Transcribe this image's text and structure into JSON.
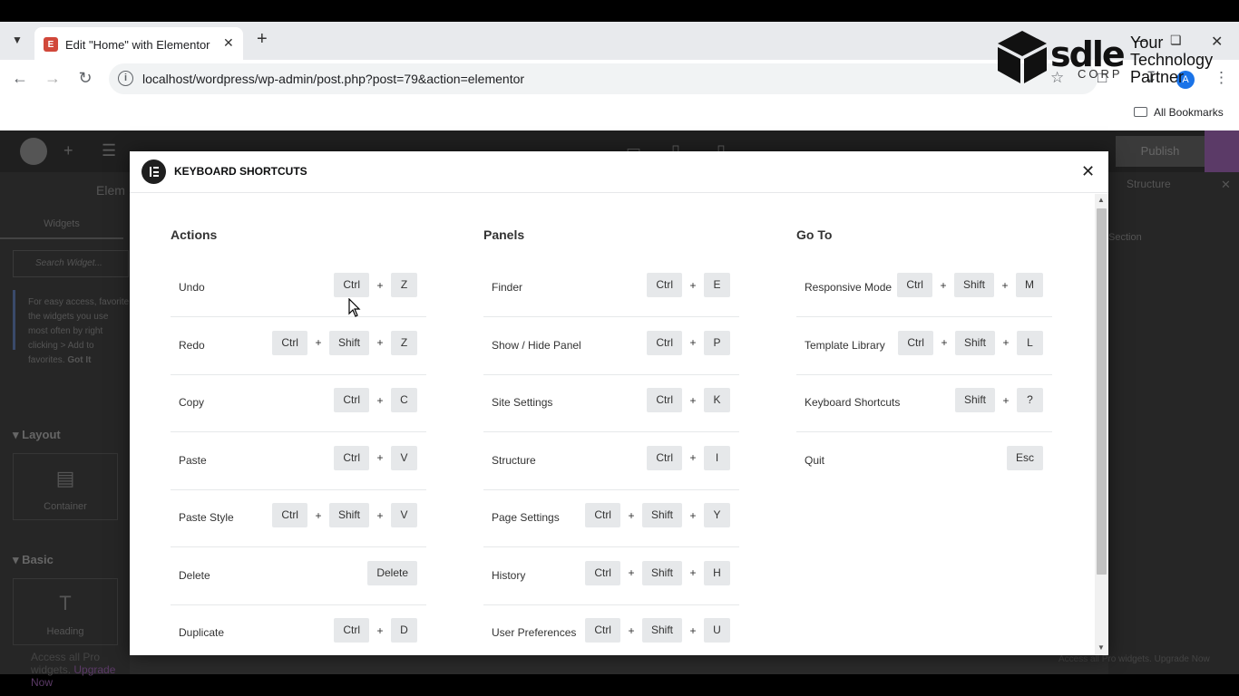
{
  "browser": {
    "tab_title": "Edit \"Home\" with Elementor",
    "url": "localhost/wordpress/wp-admin/post.php?post=79&action=elementor",
    "bookmarks_label": "All Bookmarks",
    "avatar_letter": "A"
  },
  "watermark": {
    "brand": "sdle",
    "corp": "CORP",
    "tagline": "Your Technology Partner"
  },
  "editor": {
    "left_title": "Elem",
    "left_tab": "Widgets",
    "search_placeholder": "Search Widget...",
    "note_text": "For easy access, favorite the widgets you use most often by right clicking > Add to favorites.",
    "note_link": "Got It",
    "section_layout": "Layout",
    "widget_container": "Container",
    "section_basic": "Basic",
    "widget_heading": "Heading",
    "pro_text": "Access all Pro widgets.",
    "pro_link": "Upgrade Now",
    "right_title": "Structure",
    "right_section": "Section",
    "right_pro": "Access all Pro widgets. Upgrade Now",
    "publish": "Publish"
  },
  "modal": {
    "title": "KEYBOARD SHORTCUTS",
    "columns": [
      {
        "title": "Actions",
        "rows": [
          {
            "label": "Undo",
            "keys": [
              "Ctrl",
              "Z"
            ]
          },
          {
            "label": "Redo",
            "keys": [
              "Ctrl",
              "Shift",
              "Z"
            ]
          },
          {
            "label": "Copy",
            "keys": [
              "Ctrl",
              "C"
            ]
          },
          {
            "label": "Paste",
            "keys": [
              "Ctrl",
              "V"
            ]
          },
          {
            "label": "Paste Style",
            "keys": [
              "Ctrl",
              "Shift",
              "V"
            ]
          },
          {
            "label": "Delete",
            "keys": [
              "Delete"
            ]
          },
          {
            "label": "Duplicate",
            "keys": [
              "Ctrl",
              "D"
            ]
          }
        ]
      },
      {
        "title": "Panels",
        "rows": [
          {
            "label": "Finder",
            "keys": [
              "Ctrl",
              "E"
            ]
          },
          {
            "label": "Show / Hide Panel",
            "keys": [
              "Ctrl",
              "P"
            ]
          },
          {
            "label": "Site Settings",
            "keys": [
              "Ctrl",
              "K"
            ]
          },
          {
            "label": "Structure",
            "keys": [
              "Ctrl",
              "I"
            ]
          },
          {
            "label": "Page Settings",
            "keys": [
              "Ctrl",
              "Shift",
              "Y"
            ]
          },
          {
            "label": "History",
            "keys": [
              "Ctrl",
              "Shift",
              "H"
            ]
          },
          {
            "label": "User Preferences",
            "keys": [
              "Ctrl",
              "Shift",
              "U"
            ]
          }
        ]
      },
      {
        "title": "Go To",
        "rows": [
          {
            "label": "Responsive Mode",
            "keys": [
              "Ctrl",
              "Shift",
              "M"
            ]
          },
          {
            "label": "Template Library",
            "keys": [
              "Ctrl",
              "Shift",
              "L"
            ]
          },
          {
            "label": "Keyboard Shortcuts",
            "keys": [
              "Shift",
              "?"
            ]
          },
          {
            "label": "Quit",
            "keys": [
              "Esc"
            ]
          }
        ]
      }
    ]
  },
  "colors": {
    "modal_bg": "#ffffff",
    "key_bg": "#e6e8ea",
    "editor_bg": "#2b2b2b",
    "publish_accent": "#5b3a67"
  }
}
